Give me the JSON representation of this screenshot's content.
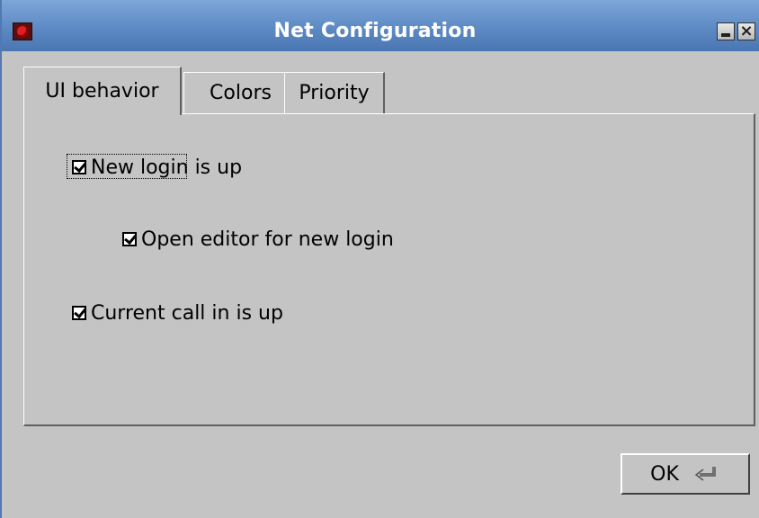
{
  "window": {
    "title": "Net Configuration"
  },
  "tabs": [
    {
      "label": "UI behavior",
      "selected": true
    },
    {
      "label": "Colors",
      "selected": false
    },
    {
      "label": "Priority",
      "selected": false
    }
  ],
  "options": [
    {
      "label": "New login is up",
      "checked": true
    },
    {
      "label": "Open editor for new login",
      "checked": true
    },
    {
      "label": "Current call in is up",
      "checked": true
    }
  ],
  "footer": {
    "ok_label": "OK"
  },
  "icons": {
    "app": "app-icon",
    "minimize": "minimize-icon",
    "close": "close-icon",
    "enter": "enter-key-icon"
  }
}
